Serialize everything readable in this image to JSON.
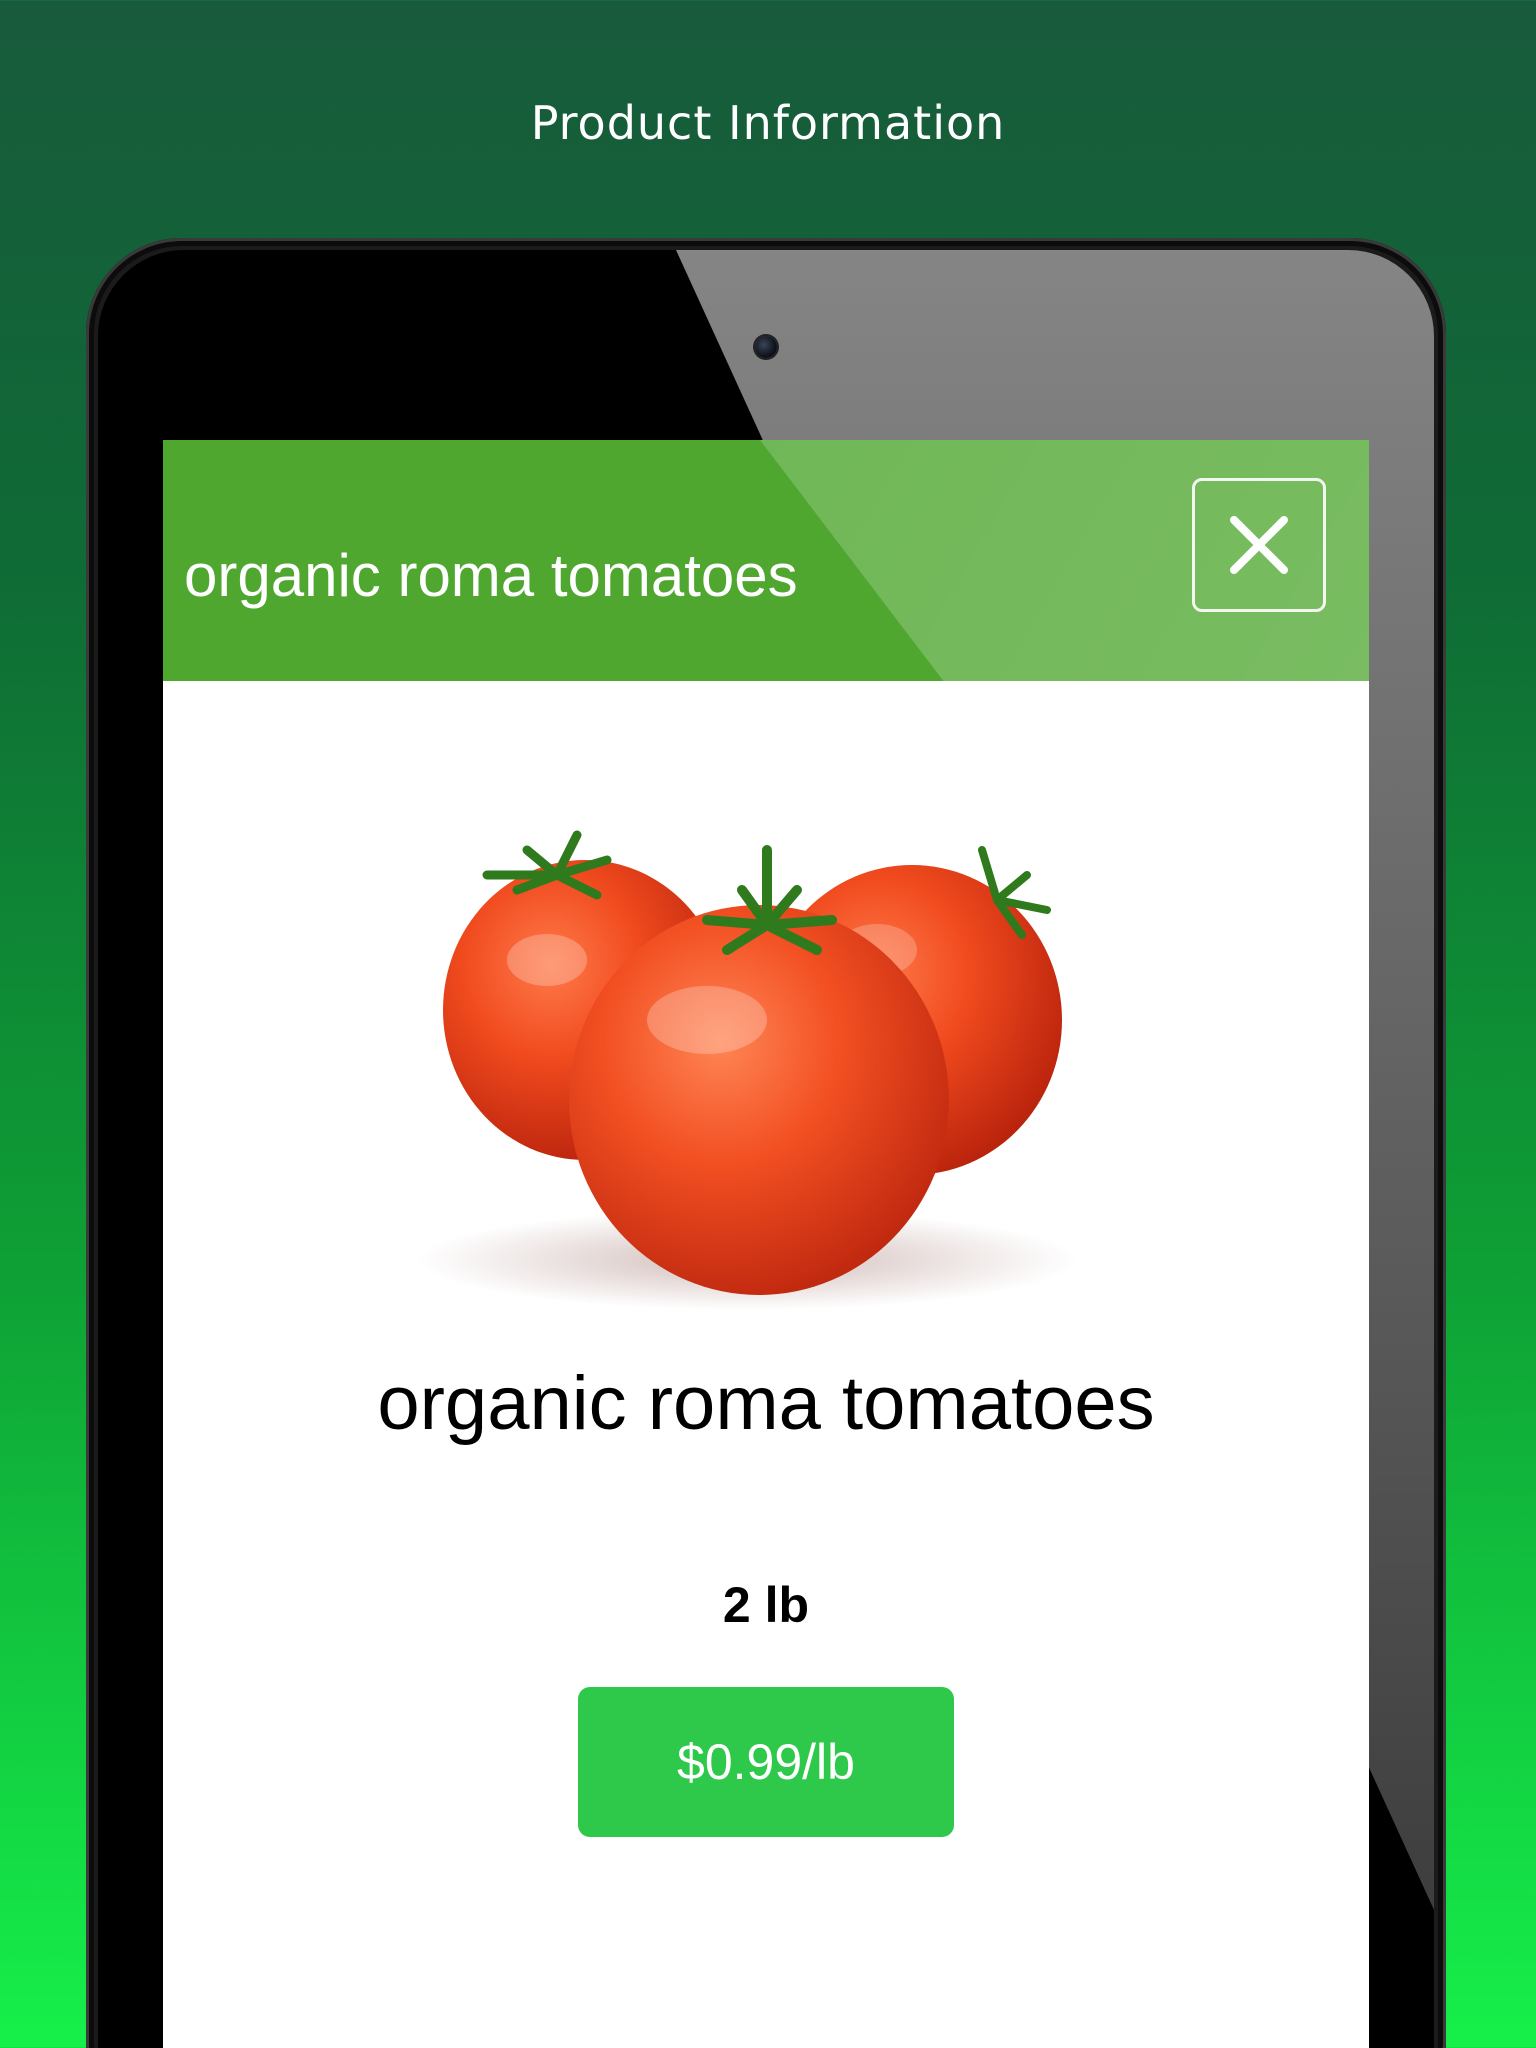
{
  "promo": {
    "title": "Product Information"
  },
  "app": {
    "header_title": "organic roma tomatoes",
    "close_icon": "close-icon"
  },
  "product": {
    "image_icon": "tomatoes-image",
    "name": "organic roma tomatoes",
    "weight": "2 lb",
    "price": "$0.99/lb"
  },
  "colors": {
    "header_green": "#4fa730",
    "price_green": "#2ec84b",
    "background_top": "#185a3c",
    "background_bottom": "#16f04a"
  }
}
